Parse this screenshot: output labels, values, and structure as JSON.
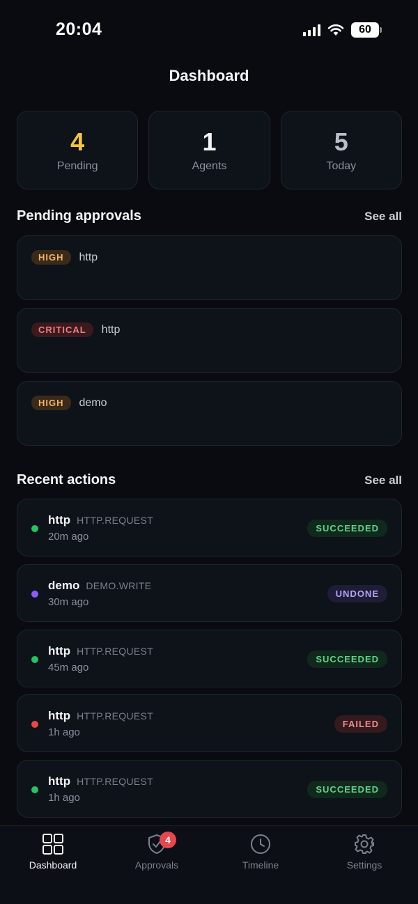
{
  "status_bar": {
    "time": "20:04",
    "battery": "60"
  },
  "header": {
    "title": "Dashboard"
  },
  "stats": [
    {
      "value": "4",
      "label": "Pending",
      "color": "#f5c542"
    },
    {
      "value": "1",
      "label": "Agents",
      "color": "#f3f4f6"
    },
    {
      "value": "5",
      "label": "Today",
      "color": "#b9bec7"
    }
  ],
  "pending": {
    "title": "Pending approvals",
    "see_all": "See all",
    "items": [
      {
        "severity": "HIGH",
        "tool": "http"
      },
      {
        "severity": "CRITICAL",
        "tool": "http"
      },
      {
        "severity": "HIGH",
        "tool": "demo"
      }
    ]
  },
  "recent": {
    "title": "Recent actions",
    "see_all": "See all",
    "items": [
      {
        "name": "http",
        "kind": "HTTP.REQUEST",
        "time": "20m ago",
        "status": "SUCCEEDED",
        "dot_color": "#22c55e"
      },
      {
        "name": "demo",
        "kind": "DEMO.WRITE",
        "time": "30m ago",
        "status": "UNDONE",
        "dot_color": "#8b5cf6"
      },
      {
        "name": "http",
        "kind": "HTTP.REQUEST",
        "time": "45m ago",
        "status": "SUCCEEDED",
        "dot_color": "#22c55e"
      },
      {
        "name": "http",
        "kind": "HTTP.REQUEST",
        "time": "1h ago",
        "status": "FAILED",
        "dot_color": "#ef4444"
      },
      {
        "name": "http",
        "kind": "HTTP.REQUEST",
        "time": "1h ago",
        "status": "SUCCEEDED",
        "dot_color": "#22c55e"
      }
    ]
  },
  "tabs": [
    {
      "label": "Dashboard",
      "icon": "grid-icon",
      "active": true
    },
    {
      "label": "Approvals",
      "icon": "shield-check-icon",
      "badge": "4"
    },
    {
      "label": "Timeline",
      "icon": "clock-icon"
    },
    {
      "label": "Settings",
      "icon": "gear-icon"
    }
  ]
}
